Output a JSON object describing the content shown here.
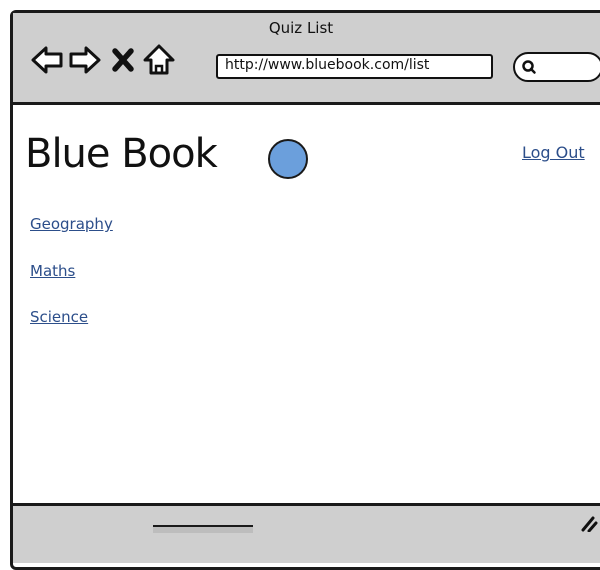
{
  "window": {
    "title": "Quiz List"
  },
  "toolbar": {
    "address": "http://www.bluebook.com/list",
    "icons": [
      "back-icon",
      "forward-icon",
      "stop-icon",
      "home-icon",
      "search-icon"
    ]
  },
  "page": {
    "brand": "Blue Book",
    "logout_label": "Log Out",
    "categories": [
      "Geography",
      "Maths",
      "Science"
    ]
  },
  "colors": {
    "logo": "#6b9fdc",
    "link": "#2c4e8a",
    "chrome": "#cfcfcf"
  }
}
